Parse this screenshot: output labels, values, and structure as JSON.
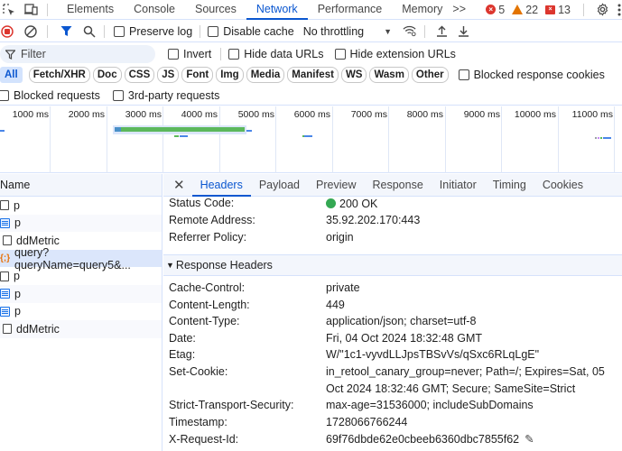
{
  "tabbar": {
    "tabs": [
      "Elements",
      "Console",
      "Sources",
      "Network",
      "Performance",
      "Memory"
    ],
    "active_tab": "Network",
    "more_label": ">>",
    "errors_count": "5",
    "warnings_count": "22",
    "issues_count": "13"
  },
  "toolbar": {
    "preserve_log": "Preserve log",
    "disable_cache": "Disable cache",
    "throttling": "No throttling"
  },
  "filterbar": {
    "filter_placeholder": "Filter",
    "invert": "Invert",
    "hide_data_urls": "Hide data URLs",
    "hide_extension_urls": "Hide extension URLs"
  },
  "typebar": {
    "types": [
      "All",
      "Fetch/XHR",
      "Doc",
      "CSS",
      "JS",
      "Font",
      "Img",
      "Media",
      "Manifest",
      "WS",
      "Wasm",
      "Other"
    ],
    "active_type": "All",
    "blocked_response_cookies": "Blocked response cookies"
  },
  "extrabar": {
    "blocked_requests": "Blocked requests",
    "third_party": "3rd-party requests"
  },
  "overview": {
    "ticks": [
      "1000 ms",
      "2000 ms",
      "3000 ms",
      "4000 ms",
      "5000 ms",
      "6000 ms",
      "7000 ms",
      "8000 ms",
      "9000 ms",
      "10000 ms",
      "11000 ms"
    ]
  },
  "reqlist": {
    "header": "Name",
    "rows": [
      {
        "name": "p",
        "icon": "document-icon"
      },
      {
        "name": "p",
        "icon": "script-icon"
      },
      {
        "name": "ddMetric",
        "icon": "document-icon"
      },
      {
        "name": "query?queryName=query5&...",
        "icon": "xhr-icon",
        "selected": true
      },
      {
        "name": "p",
        "icon": "document-icon"
      },
      {
        "name": "p",
        "icon": "script-icon"
      },
      {
        "name": "p",
        "icon": "script-icon"
      },
      {
        "name": "ddMetric",
        "icon": "document-icon"
      }
    ]
  },
  "details": {
    "tabs": [
      "Headers",
      "Payload",
      "Preview",
      "Response",
      "Initiator",
      "Timing",
      "Cookies"
    ],
    "active_tab": "Headers",
    "general": [
      {
        "key": "Status Code:",
        "value": "200 OK"
      },
      {
        "key": "Remote Address:",
        "value": "35.92.202.170:443"
      },
      {
        "key": "Referrer Policy:",
        "value": "origin"
      }
    ],
    "response_section_title": "Response Headers",
    "response_headers": [
      {
        "key": "Cache-Control:",
        "value": "private"
      },
      {
        "key": "Content-Length:",
        "value": "449"
      },
      {
        "key": "Content-Type:",
        "value": "application/json; charset=utf-8"
      },
      {
        "key": "Date:",
        "value": "Fri, 04 Oct 2024 18:32:48 GMT"
      },
      {
        "key": "Etag:",
        "value": "W/\"1c1-vyvdLLJpsTBSvVs/qSxc6RLqLgE\""
      },
      {
        "key": "Set-Cookie:",
        "value": "in_retool_canary_group=never; Path=/; Expires=Sat, 05 Oct 2024 18:32:46 GMT; Secure; SameSite=Strict"
      },
      {
        "key": "Strict-Transport-Security:",
        "value": "max-age=31536000; includeSubDomains"
      },
      {
        "key": "Timestamp:",
        "value": "1728066766244"
      },
      {
        "key": "X-Request-Id:",
        "value": "69f76dbde62e0cbeeb6360dbc7855f62"
      }
    ]
  },
  "colors": {
    "accent": "#0b57d0",
    "status_ok": "#34a853",
    "error": "#dc362e",
    "warning": "#e37400"
  }
}
